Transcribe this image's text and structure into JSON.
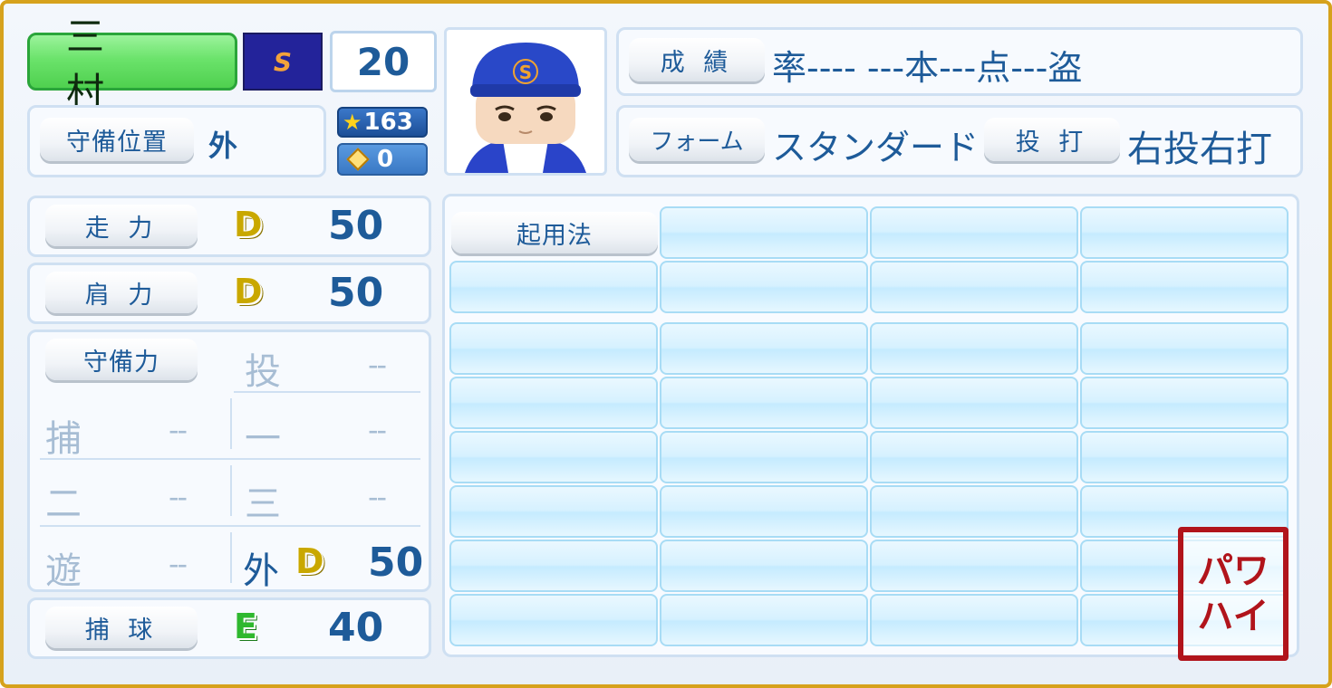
{
  "player": {
    "name": "三 村",
    "team_logo_letter": "S",
    "number": "20",
    "stars": "163",
    "diamond": "0"
  },
  "header": {
    "stats_label": "成 績",
    "stats_value": "率---- ---本---点---盗",
    "form_label": "フォーム",
    "form_value": "スタンダード１",
    "bat_label": "投 打",
    "bat_value": "右投右打"
  },
  "position": {
    "label": "守備位置",
    "value": "外"
  },
  "abilities": [
    {
      "label": "走 力",
      "grade": "D",
      "value": "50"
    },
    {
      "label": "肩 力",
      "grade": "D",
      "value": "50"
    },
    {
      "label": "捕 球",
      "grade": "E",
      "value": "40"
    }
  ],
  "defense": {
    "label": "守備力",
    "positions": [
      {
        "name": "投",
        "value": "--"
      },
      {
        "name": "捕",
        "value": "--"
      },
      {
        "name": "一",
        "value": "--"
      },
      {
        "name": "二",
        "value": "--"
      },
      {
        "name": "三",
        "value": "--"
      },
      {
        "name": "遊",
        "value": "--"
      },
      {
        "name": "外",
        "grade": "D",
        "value": "50"
      }
    ]
  },
  "special": {
    "usage_label": "起用法"
  },
  "stamp": {
    "line1": "パワ",
    "line2": "ハイ"
  },
  "colors": {
    "frame": "#d6a21c",
    "text_blue": "#1e5b99",
    "name_green": "#6be36b",
    "grade_D": "#c9a800",
    "grade_E": "#2fb82f",
    "stamp_red": "#b1141b"
  }
}
